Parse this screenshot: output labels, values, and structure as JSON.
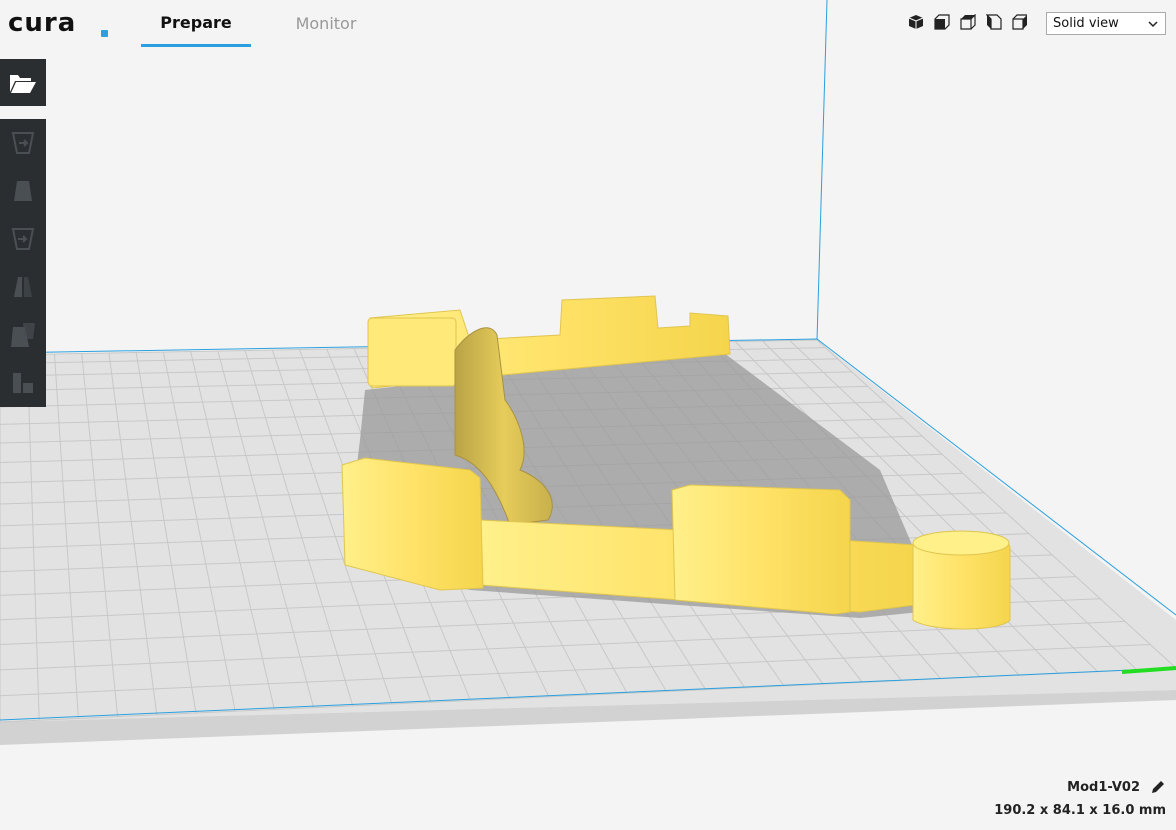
{
  "app": {
    "logo_text": "cura",
    "accent": "#2aa0e0"
  },
  "tabs": [
    {
      "label": "Prepare",
      "active": true
    },
    {
      "label": "Monitor",
      "active": false
    }
  ],
  "toolbar": {
    "open_icon": "folder-open-icon",
    "tools": [
      "move-tool-icon",
      "scale-tool-icon",
      "rotate-tool-icon",
      "mirror-tool-icon",
      "per-model-settings-icon",
      "support-blocker-icon"
    ]
  },
  "view_buttons": [
    "3d-view-icon",
    "front-view-icon",
    "top-view-icon",
    "left-view-icon",
    "right-view-icon"
  ],
  "view_mode": {
    "selected": "Solid view"
  },
  "model": {
    "name": "Mod1-V02",
    "dimensions": "190.2 x 84.1 x 16.0 mm",
    "color": "#ffe572"
  }
}
